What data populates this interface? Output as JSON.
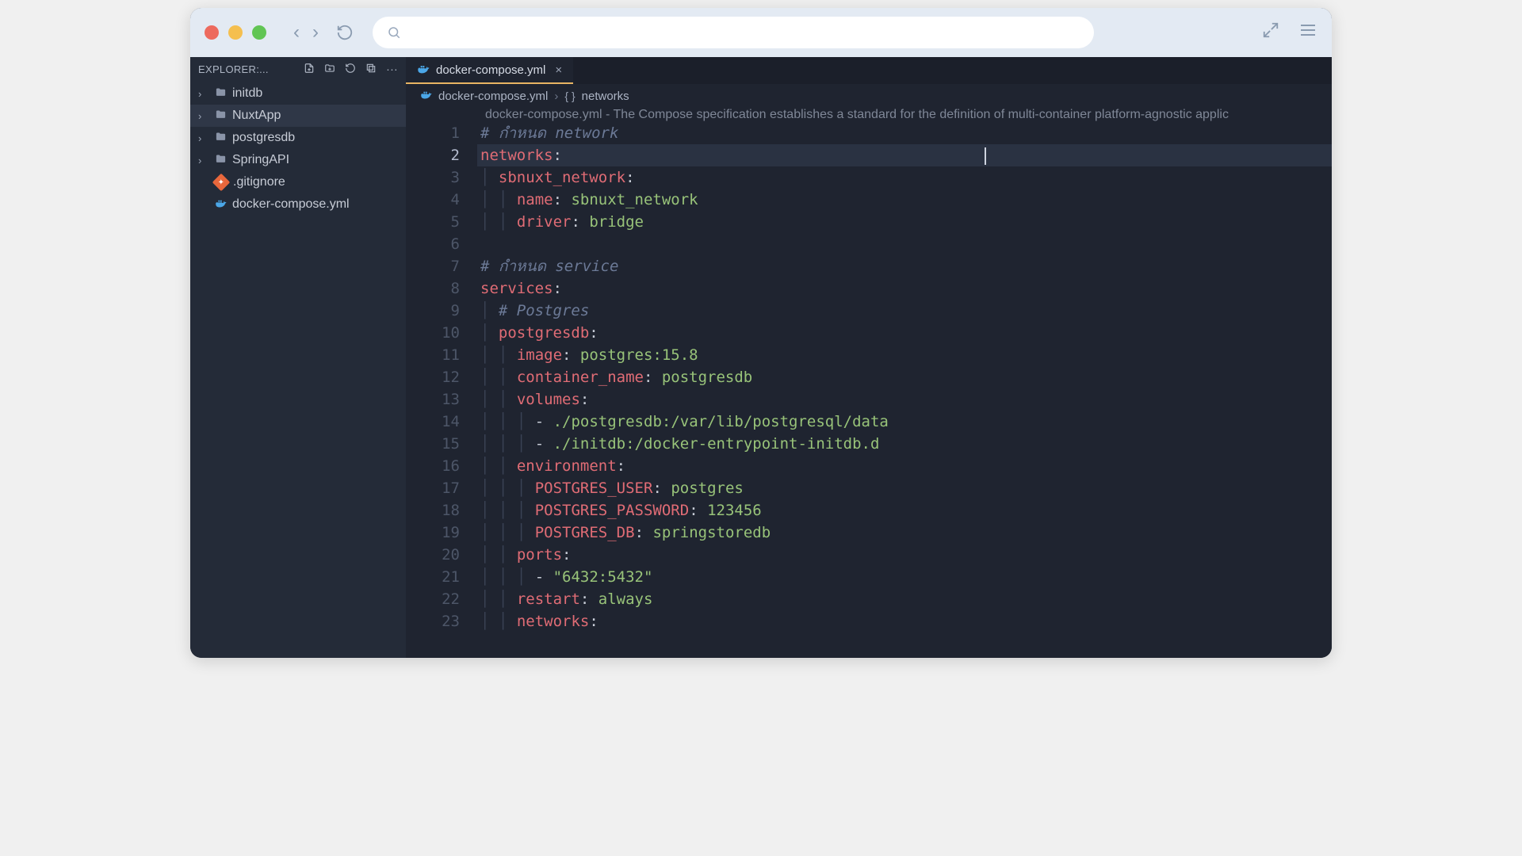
{
  "sidebar": {
    "title": "EXPLORER:...",
    "items": [
      {
        "type": "folder",
        "name": "initdb",
        "selected": false
      },
      {
        "type": "folder",
        "name": "NuxtApp",
        "selected": true
      },
      {
        "type": "folder",
        "name": "postgresdb",
        "selected": false
      },
      {
        "type": "folder",
        "name": "SpringAPI",
        "selected": false
      },
      {
        "type": "gitignore",
        "name": ".gitignore",
        "selected": false
      },
      {
        "type": "docker",
        "name": "docker-compose.yml",
        "selected": false
      }
    ]
  },
  "tab": {
    "file": "docker-compose.yml"
  },
  "breadcrumb": {
    "file": "docker-compose.yml",
    "sep": "›",
    "braces": "{ }",
    "symbol": "networks"
  },
  "hint": "docker-compose.yml - The Compose specification establishes a standard for the definition of multi-container platform-agnostic applic",
  "code": {
    "lines": [
      {
        "n": 1,
        "tokens": [
          {
            "t": "# กำหนด network",
            "c": "c-comment"
          }
        ]
      },
      {
        "n": 2,
        "hl": true,
        "tokens": [
          {
            "t": "networks",
            "c": "c-key"
          },
          {
            "t": ":",
            "c": "c-punct"
          }
        ]
      },
      {
        "n": 3,
        "indent": 1,
        "tokens": [
          {
            "t": "sbnuxt_network",
            "c": "c-key"
          },
          {
            "t": ":",
            "c": "c-punct"
          }
        ]
      },
      {
        "n": 4,
        "indent": 2,
        "tokens": [
          {
            "t": "name",
            "c": "c-key"
          },
          {
            "t": ": ",
            "c": "c-punct"
          },
          {
            "t": "sbnuxt_network",
            "c": "c-str"
          }
        ]
      },
      {
        "n": 5,
        "indent": 2,
        "tokens": [
          {
            "t": "driver",
            "c": "c-key"
          },
          {
            "t": ": ",
            "c": "c-punct"
          },
          {
            "t": "bridge",
            "c": "c-str"
          }
        ]
      },
      {
        "n": 6,
        "tokens": [
          {
            "t": "",
            "c": ""
          }
        ]
      },
      {
        "n": 7,
        "tokens": [
          {
            "t": "# กำหนด service",
            "c": "c-comment"
          }
        ]
      },
      {
        "n": 8,
        "tokens": [
          {
            "t": "services",
            "c": "c-key"
          },
          {
            "t": ":",
            "c": "c-punct"
          }
        ]
      },
      {
        "n": 9,
        "indent": 1,
        "tokens": [
          {
            "t": "# Postgres",
            "c": "c-comment"
          }
        ]
      },
      {
        "n": 10,
        "indent": 1,
        "tokens": [
          {
            "t": "postgresdb",
            "c": "c-key"
          },
          {
            "t": ":",
            "c": "c-punct"
          }
        ]
      },
      {
        "n": 11,
        "indent": 2,
        "tokens": [
          {
            "t": "image",
            "c": "c-key"
          },
          {
            "t": ": ",
            "c": "c-punct"
          },
          {
            "t": "postgres:15.8",
            "c": "c-str"
          }
        ]
      },
      {
        "n": 12,
        "indent": 2,
        "tokens": [
          {
            "t": "container_name",
            "c": "c-key"
          },
          {
            "t": ": ",
            "c": "c-punct"
          },
          {
            "t": "postgresdb",
            "c": "c-str"
          }
        ]
      },
      {
        "n": 13,
        "indent": 2,
        "tokens": [
          {
            "t": "volumes",
            "c": "c-key"
          },
          {
            "t": ":",
            "c": "c-punct"
          }
        ]
      },
      {
        "n": 14,
        "indent": 3,
        "tokens": [
          {
            "t": "- ",
            "c": "c-dash"
          },
          {
            "t": "./postgresdb:/var/lib/postgresql/data",
            "c": "c-str"
          }
        ]
      },
      {
        "n": 15,
        "indent": 3,
        "tokens": [
          {
            "t": "- ",
            "c": "c-dash"
          },
          {
            "t": "./initdb:/docker-entrypoint-initdb.d",
            "c": "c-str"
          }
        ]
      },
      {
        "n": 16,
        "indent": 2,
        "tokens": [
          {
            "t": "environment",
            "c": "c-key"
          },
          {
            "t": ":",
            "c": "c-punct"
          }
        ]
      },
      {
        "n": 17,
        "indent": 3,
        "tokens": [
          {
            "t": "POSTGRES_USER",
            "c": "c-key"
          },
          {
            "t": ": ",
            "c": "c-punct"
          },
          {
            "t": "postgres",
            "c": "c-str"
          }
        ]
      },
      {
        "n": 18,
        "indent": 3,
        "tokens": [
          {
            "t": "POSTGRES_PASSWORD",
            "c": "c-key"
          },
          {
            "t": ": ",
            "c": "c-punct"
          },
          {
            "t": "123456",
            "c": "c-str"
          }
        ]
      },
      {
        "n": 19,
        "indent": 3,
        "tokens": [
          {
            "t": "POSTGRES_DB",
            "c": "c-key"
          },
          {
            "t": ": ",
            "c": "c-punct"
          },
          {
            "t": "springstoredb",
            "c": "c-str"
          }
        ]
      },
      {
        "n": 20,
        "indent": 2,
        "tokens": [
          {
            "t": "ports",
            "c": "c-key"
          },
          {
            "t": ":",
            "c": "c-punct"
          }
        ]
      },
      {
        "n": 21,
        "indent": 3,
        "tokens": [
          {
            "t": "- ",
            "c": "c-dash"
          },
          {
            "t": "\"6432:5432\"",
            "c": "c-str"
          }
        ]
      },
      {
        "n": 22,
        "indent": 2,
        "tokens": [
          {
            "t": "restart",
            "c": "c-key"
          },
          {
            "t": ": ",
            "c": "c-punct"
          },
          {
            "t": "always",
            "c": "c-str"
          }
        ]
      },
      {
        "n": 23,
        "indent": 2,
        "tokens": [
          {
            "t": "networks",
            "c": "c-key"
          },
          {
            "t": ":",
            "c": "c-punct"
          }
        ]
      }
    ]
  }
}
